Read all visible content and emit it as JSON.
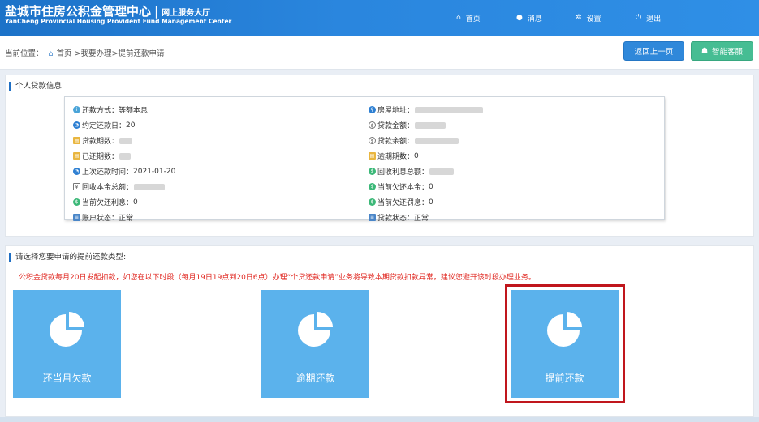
{
  "header": {
    "title_cn": "盐城市住房公积金管理中心",
    "title_sep": "|",
    "title_sub": "网上服务大厅",
    "title_en": "YanCheng Provincial Housing Provident Fund Management Center",
    "nav": [
      {
        "label": "首页",
        "icon": "home-icon"
      },
      {
        "label": "消息",
        "icon": "message-icon"
      },
      {
        "label": "设置",
        "icon": "gear-icon"
      },
      {
        "label": "退出",
        "icon": "power-icon"
      }
    ]
  },
  "breadcrumb": {
    "prefix": "当前位置：",
    "path": "首页 >我要办理>提前还款申请"
  },
  "buttons": {
    "back": "返回上一页",
    "help": "智能客服"
  },
  "loan_info": {
    "title": "个人贷款信息",
    "left": [
      {
        "label": "还款方式：",
        "value": "等额本息"
      },
      {
        "label": "约定还款日：",
        "value": "20"
      },
      {
        "label": "贷款期数：",
        "value": ""
      },
      {
        "label": "已还期数：",
        "value": ""
      },
      {
        "label": "上次还款时间：",
        "value": "2021-01-20"
      },
      {
        "label": "回收本金总额：",
        "value": ""
      },
      {
        "label": "当前欠还利息：",
        "value": "0"
      },
      {
        "label": "账户状态：",
        "value": "正常"
      }
    ],
    "right": [
      {
        "label": "房屋地址：",
        "value": ""
      },
      {
        "label": "贷款金额：",
        "value": ""
      },
      {
        "label": "贷款余额：",
        "value": ""
      },
      {
        "label": "逾期期数：",
        "value": "0"
      },
      {
        "label": "回收利息总额：",
        "value": ""
      },
      {
        "label": "当前欠还本金：",
        "value": "0"
      },
      {
        "label": "当前欠还罚息：",
        "value": "0"
      },
      {
        "label": "贷款状态：",
        "value": "正常"
      }
    ]
  },
  "repay_types": {
    "title": "请选择您要申请的提前还款类型:",
    "notice": "公积金贷款每月20日发起扣款，如您在以下时段（每月19日19点到20日6点）办理“个贷还款申请”业务将导致本期贷款扣款异常，建议您避开该时段办理业务。",
    "tiles": [
      {
        "label": "还当月欠款",
        "icon": "pie-chart-icon"
      },
      {
        "label": "逾期还款",
        "icon": "pie-chart-icon"
      },
      {
        "label": "提前还款",
        "icon": "pie-chart-icon"
      }
    ],
    "selected_index": 2
  },
  "colors": {
    "header": "#2a86de",
    "tile": "#5bb2ec",
    "notice": "#e0261f",
    "highlight": "#c0161d",
    "help_button": "#46bd93",
    "back_button": "#2f88da"
  }
}
